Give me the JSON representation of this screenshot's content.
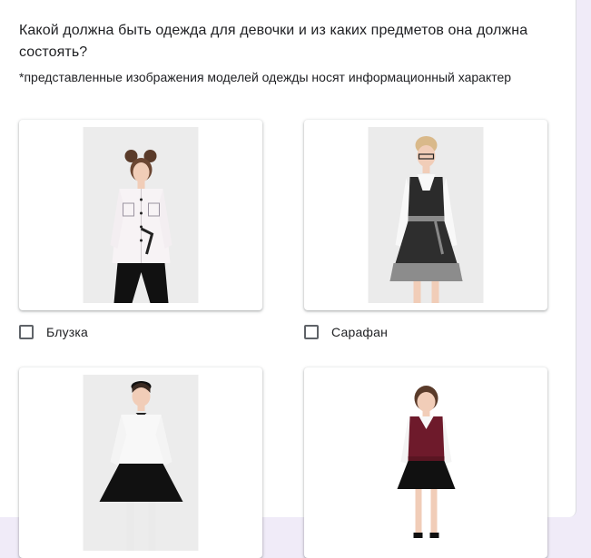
{
  "question": {
    "title": "Какой должна быть одежда для девочки и из каких предметов она должна состоять?",
    "description": "*представленные изображения моделей одежды носят информационный характер"
  },
  "options": [
    {
      "label": "Блузка",
      "checked": false,
      "image_icon": "girl-in-white-blouse-photo"
    },
    {
      "label": "Сарафан",
      "checked": false,
      "image_icon": "girl-in-grey-sundress-photo"
    },
    {
      "label": "",
      "checked": false,
      "image_icon": "girl-in-black-skirt-photo"
    },
    {
      "label": "",
      "checked": false,
      "image_icon": "girl-in-burgundy-vest-photo"
    }
  ],
  "colors": {
    "background": "#f0ebf8",
    "card": "#ffffff",
    "text": "#202124",
    "checkbox_border": "#5f6368"
  }
}
